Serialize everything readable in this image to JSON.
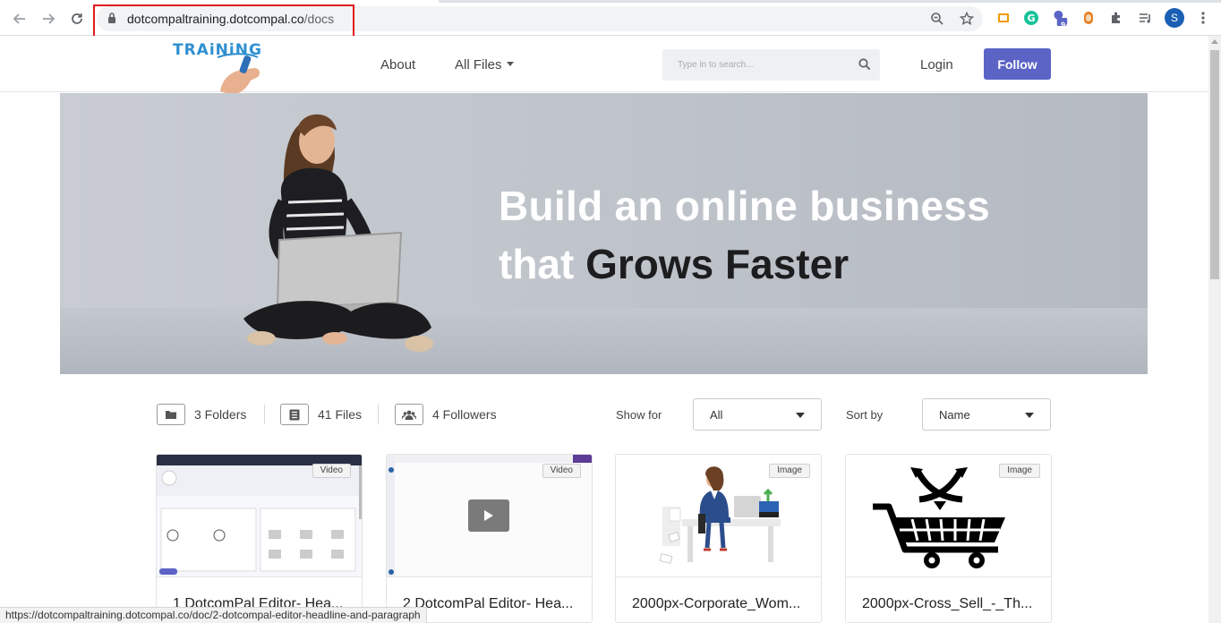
{
  "browser": {
    "url_domain": "dotcompaltraining.dotcompal.co",
    "url_path": "/docs",
    "profile_initial": "S",
    "extension_badge": "9+",
    "status_url": "https://dotcompaltraining.dotcompal.co/doc/2-dotcompal-editor-headline-and-paragraph"
  },
  "header": {
    "logo_text": "TRAiNiNG",
    "nav_about": "About",
    "nav_all_files": "All Files",
    "search_placeholder": "Type in to search...",
    "login": "Login",
    "follow": "Follow"
  },
  "hero": {
    "line1": "Build an online business",
    "line2_light": "that ",
    "line2_dark": "Grows Faster"
  },
  "stats": {
    "folders": "3 Folders",
    "files": "41 Files",
    "followers": "4 Followers"
  },
  "filters": {
    "show_for_label": "Show for",
    "show_for_value": "All",
    "sort_by_label": "Sort by",
    "sort_by_value": "Name"
  },
  "cards": [
    {
      "badge": "Video",
      "title": "1 DotcomPal Editor- Hea..."
    },
    {
      "badge": "Video",
      "title": "2 DotcomPal Editor- Hea..."
    },
    {
      "badge": "Image",
      "title": "2000px-Corporate_Wom..."
    },
    {
      "badge": "Image",
      "title": "2000px-Cross_Sell_-_Th..."
    }
  ],
  "colors": {
    "accent": "#5b63c5",
    "highlight_box": "#e21b1b"
  }
}
